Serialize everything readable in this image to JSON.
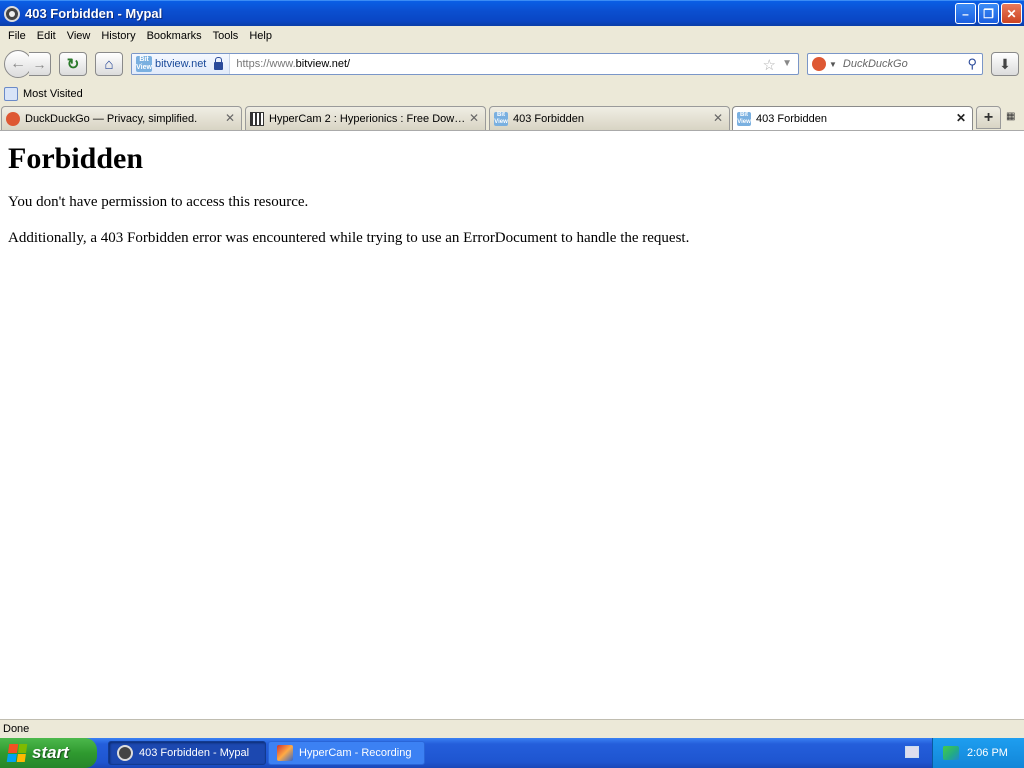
{
  "window": {
    "title": "403 Forbidden - Mypal"
  },
  "menu": [
    "File",
    "Edit",
    "View",
    "History",
    "Bookmarks",
    "Tools",
    "Help"
  ],
  "navbar": {
    "site_identity": "bitview.net",
    "url_proto": "https://www.",
    "url_rest": "bitview.net/",
    "search_placeholder": "DuckDuckGo"
  },
  "bookmarks": {
    "most_visited": "Most Visited"
  },
  "tabs": [
    {
      "label": "DuckDuckGo — Privacy, simplified.",
      "icon": "duckduckgo-icon"
    },
    {
      "label": "HyperCam 2 : Hyperionics : Free Downl...",
      "icon": "archive-icon"
    },
    {
      "label": "403 Forbidden",
      "icon": "bitview-icon"
    },
    {
      "label": "403 Forbidden",
      "icon": "bitview-icon",
      "active": true
    }
  ],
  "page": {
    "heading": "Forbidden",
    "para1": "You don't have permission to access this resource.",
    "para2": "Additionally, a 403 Forbidden error was encountered while trying to use an ErrorDocument to handle the request."
  },
  "status": {
    "text": "Done"
  },
  "taskbar": {
    "start": "start",
    "tasks": [
      "403 Forbidden - Mypal",
      "HyperCam - Recording"
    ],
    "clock": "2:06 PM"
  },
  "colors": {
    "xp_blue": "#245edb",
    "start_green": "#2f9a2f",
    "tray_blue": "#1286d8"
  }
}
